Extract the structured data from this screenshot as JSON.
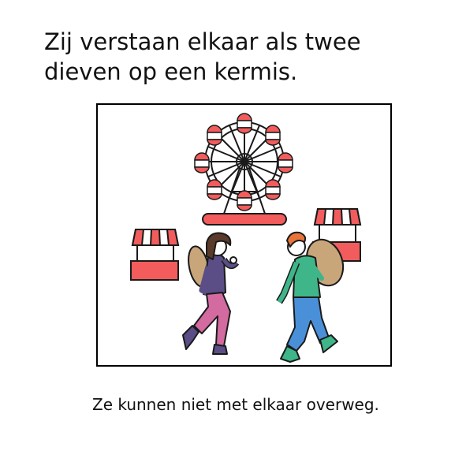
{
  "title": "Zij verstaan elkaar als twee dieven op een kermis.",
  "caption": "Ze kunnen niet met elkaar overweg.",
  "colors": {
    "red": "#f25c5c",
    "outline": "#1a1a1a",
    "purple_shirt": "#5b4e86",
    "pink_pants": "#d36aa0",
    "green_shirt": "#3fb58a",
    "blue_pants": "#4a90d9",
    "sack": "#c9a57a",
    "hair_brown": "#5a3b2a",
    "hair_orange": "#e8743a"
  }
}
